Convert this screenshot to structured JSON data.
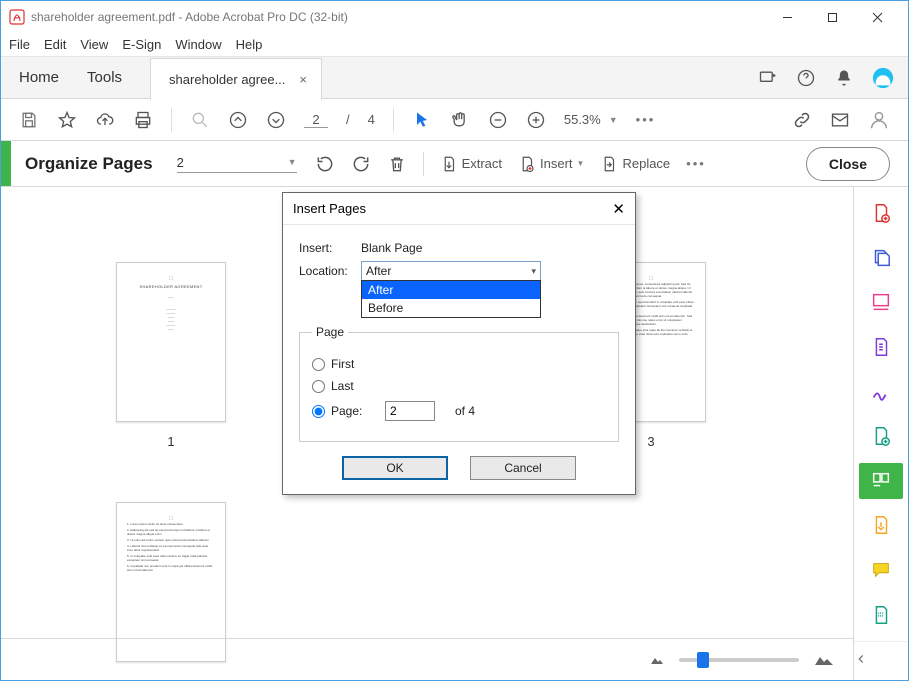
{
  "titlebar": {
    "text": "shareholder agreement.pdf - Adobe Acrobat Pro DC (32-bit)"
  },
  "menubar": {
    "file": "File",
    "edit": "Edit",
    "view": "View",
    "esign": "E-Sign",
    "window": "Window",
    "help": "Help"
  },
  "tabs": {
    "home": "Home",
    "tools": "Tools",
    "filetab": "shareholder agree...",
    "close": "×"
  },
  "toolbar": {
    "page_current": "2",
    "page_sep": "/",
    "page_total": "4",
    "zoom": "55.3%"
  },
  "organize": {
    "title": "Organize Pages",
    "pageselect": "2",
    "extract": "Extract",
    "insert": "Insert",
    "replace": "Replace",
    "close": "Close"
  },
  "thumbs": {
    "t1": "1",
    "t3": "3"
  },
  "dialog": {
    "title": "Insert Pages",
    "insert_label": "Insert:",
    "insert_value": "Blank Page",
    "location_label": "Location:",
    "location_value": "After",
    "options": {
      "after": "After",
      "before": "Before"
    },
    "page_legend": "Page",
    "first": "First",
    "last": "Last",
    "page_label": "Page:",
    "page_value": "2",
    "of": "of 4",
    "ok": "OK",
    "cancel": "Cancel"
  },
  "bottombar": {}
}
